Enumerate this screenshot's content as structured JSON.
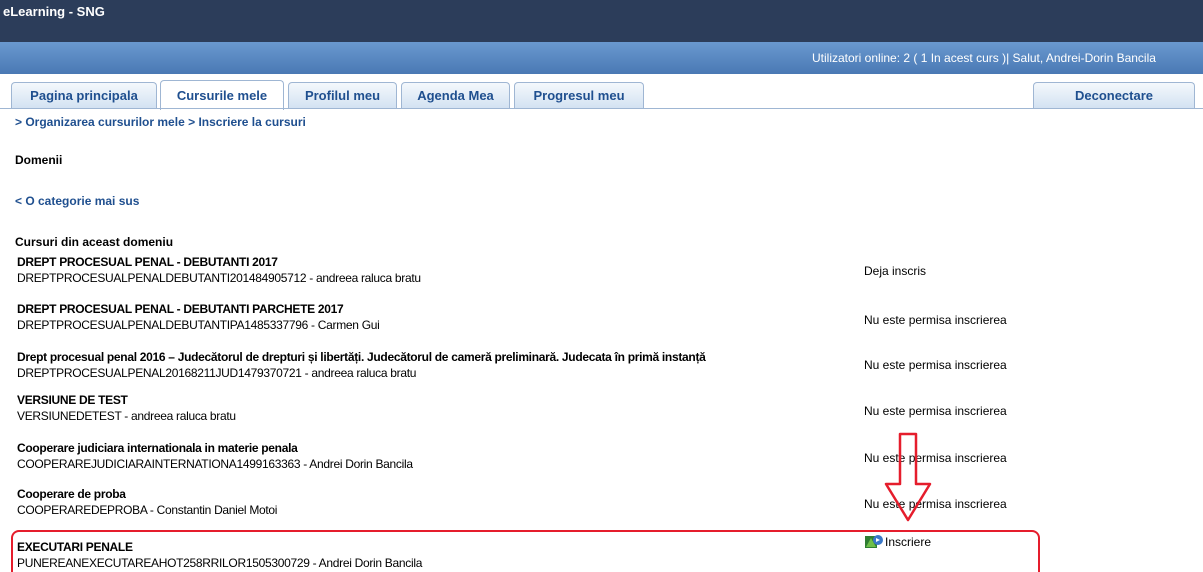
{
  "app": {
    "title": "eLearning - SNG"
  },
  "userbar": {
    "online_text": "Utilizatori online:  2  ( 1 In acest curs  )| Salut, Andrei-Dorin Bancila"
  },
  "tabs": [
    {
      "label": "Pagina principala",
      "active": false
    },
    {
      "label": "Cursurile mele",
      "active": true
    },
    {
      "label": "Profilul meu",
      "active": false
    },
    {
      "label": "Agenda Mea",
      "active": false
    },
    {
      "label": "Progresul meu",
      "active": false
    }
  ],
  "logout_label": "Deconectare",
  "breadcrumb": {
    "part1": "> Organizarea cursurilor mele",
    "sep": " > ",
    "part2": "Inscriere la cursuri"
  },
  "domains_title": "Domenii",
  "up_link": "< O categorie mai sus",
  "courses_title": "Cursuri din aceast domeniu",
  "courses": [
    {
      "name": "DREPT PROCESUAL PENAL - DEBUTANTI 2017",
      "code": "DREPTPROCESUALPENALDEBUTANTI201484905712 - andreea raluca bratu",
      "status": "Deja inscris"
    },
    {
      "name": "DREPT PROCESUAL PENAL - DEBUTANTI PARCHETE 2017",
      "code": "DREPTPROCESUALPENALDEBUTANTIPA1485337796 - Carmen Gui",
      "status": "Nu este permisa inscrierea"
    },
    {
      "name": "Drept procesual penal 2016 – Judecătorul de drepturi și libertăți. Judecătorul de cameră preliminară. Judecata în primă instanță",
      "code": "DREPTPROCESUALPENAL20168211JUD1479370721 - andreea raluca bratu",
      "status": "Nu este permisa inscrierea"
    },
    {
      "name": "VERSIUNE DE TEST",
      "code": "VERSIUNEDETEST - andreea raluca bratu",
      "status": "Nu este permisa inscrierea"
    },
    {
      "name": "Cooperare judiciara internationala in materie penala",
      "code": "COOPERAREJUDICIARAINTERNATIONA1499163363 - Andrei Dorin Bancila",
      "status": "Nu este permisa inscrierea"
    },
    {
      "name": "Cooperare de proba",
      "code": "COOPERAREDEPROBA - Constantin Daniel Motoi",
      "status": "Nu este permisa inscrierea"
    },
    {
      "name": "EXECUTARI PENALE",
      "code": "PUNEREANEXECUTAREAHOT258RRILOR1505300729 - Andrei Dorin Bancila",
      "status": "Inscriere"
    }
  ],
  "colors": {
    "titlebar": "#2c3d5a",
    "userbar": "#5a89c2",
    "link": "#1f4f8f",
    "highlight": "#e51d2c"
  },
  "icons": {
    "enroll": "enroll-icon",
    "annotation": "down-arrow-annotation"
  }
}
